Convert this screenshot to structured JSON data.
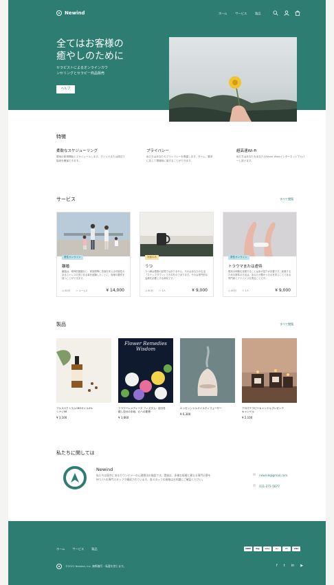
{
  "brand": {
    "name": "Newind",
    "accent": "#2d7d72"
  },
  "nav": {
    "links": [
      "ホーム",
      "サービス",
      "製品"
    ],
    "icons": [
      "search-icon",
      "user-icon",
      "bag-icon"
    ]
  },
  "hero": {
    "title_line1": "全てはお客様の",
    "title_line2": "癒やしのために",
    "subtitle_line1": "セラピストによるオンラインカウ",
    "subtitle_line2": "ンセリングとセラピー商品販売",
    "button_label": "ヘルプ"
  },
  "features": {
    "heading": "特徴",
    "items": [
      {
        "title": "柔軟なスケジューリング",
        "desc": "現地の新規開始とスケジュールします。グリッドまたは周辺で接続を確保できます。"
      },
      {
        "title": "プライバシー",
        "desc": "私たちはあなたのプライバシーを尊重します。ターム、要求に応じて環境時に保することができます。"
      },
      {
        "title": "超高速Wi-Fi",
        "desc": "私たちはあなたをあなたのWorld Wideインターネットでカバーし抜けます。"
      }
    ]
  },
  "services": {
    "heading": "サービス",
    "see_all": "すべて閲覧",
    "cards": [
      {
        "tag": "男性オンライン",
        "tag_color": "#bfe3ec",
        "title": "離婚",
        "desc": "離婚は、精神的困難なし、家族間等に苦痛を伴える可能性のあるストレスの多いある事を経験したことに、貴様の要件を保つことができます。",
        "duration": "60分",
        "mode": "ルームS",
        "price": "¥ 14,000"
      },
      {
        "tag": "対面のみ",
        "tag_color": "#f6e3a8",
        "title": "うつ",
        "desc": "うつ病は根拠の記憶ではありません。それはあなたの生活「ステップダウン」できなをのであります。それは専門的な治療を必要とする病気です。",
        "duration": "60分",
        "mode": "1人",
        "price": "¥ 9,000"
      },
      {
        "tag": "男性オンライン",
        "tag_color": "#bfe3ec",
        "title": "トラウマまたは虐待",
        "desc": "現状の体験を克服することは本の技力が必要です。前進するための基準の方法は、あなたが悪かったのを学ぶことである専門家とアドバイスを得ることです。",
        "duration": "60分",
        "mode": "1人",
        "price": "¥ 9,000"
      }
    ]
  },
  "products": {
    "heading": "製品",
    "see_all": "すべて閲覧",
    "items": [
      {
        "name": "フルスペクトラムCBDオイル4%",
        "name2": "シナジ98",
        "price": "¥ 3,100"
      },
      {
        "name": "フラワーレメディーズ フィズダム：自分を",
        "name2": "癒し自分の手段、心への癒想",
        "price": "¥ 1,660",
        "book_title": "Flower Remedies",
        "book_title2": "Wisdom"
      },
      {
        "name": "エッセンシャルオイルディフューザー",
        "name2": "",
        "price": "¥ 6,300"
      },
      {
        "name": "アロマテラピーキャンドルプレゼンテ",
        "name2": "キャンドル",
        "price": "¥ 2,100"
      }
    ]
  },
  "about": {
    "heading": "私たちに関しては",
    "name": "Newind",
    "desc": "私たちは東京にあるカウンセラーの心理療法の施設です。実施は、多様な経験と異なる専門分野を持つ7人の専門スタッフで構成されています。各スタッフの資格はお知識にご確認ください。",
    "email": "newind@gmail.com",
    "phone": "011-272-5677"
  },
  "footer": {
    "links": [
      "ホーム",
      "サービス",
      "製品"
    ],
    "copyright": "©2021 Newind, Inc. 無断複写・転載を禁じます。",
    "payments": [
      "AMEX",
      "Pay",
      "GPay",
      "MC",
      "PP",
      "VISA"
    ],
    "social": [
      "f",
      "t",
      "in",
      "yt"
    ]
  }
}
